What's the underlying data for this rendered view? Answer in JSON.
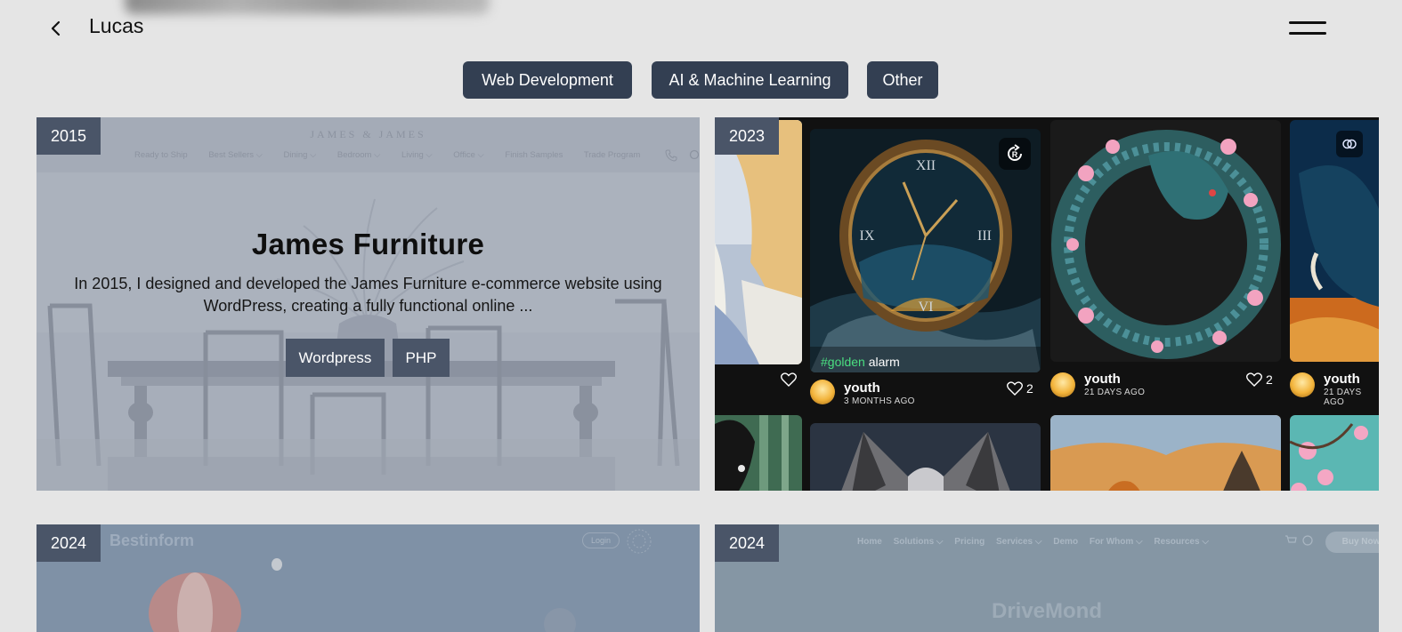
{
  "header": {
    "title": "Lucas"
  },
  "filters": [
    "Web Development",
    "AI & Machine Learning",
    "Other"
  ],
  "projects": [
    {
      "year": "2015",
      "title": "James Furniture",
      "description": "In 2015, I designed and developed the James Furniture e-commerce website using WordPress, creating a fully functional online ...",
      "tags": [
        "Wordpress",
        "PHP"
      ],
      "screenshot": {
        "brand": "JAMES & JAMES",
        "nav": [
          "Ready to Ship",
          "Best Sellers ⌵",
          "Dining ⌵",
          "Bedroom ⌵",
          "Living ⌵",
          "Office ⌵",
          "Finish Samples",
          "Trade Program"
        ]
      }
    },
    {
      "year": "2023",
      "screenshot": {
        "caption_tag": "#golden",
        "caption_word": "alarm",
        "posts": [
          {
            "user": "youth",
            "ago": "3 MONTHS AGO",
            "likes": "2"
          },
          {
            "user": "youth",
            "ago": "21 DAYS AGO",
            "likes": "2"
          },
          {
            "user": "youth",
            "ago": "21 DAYS AGO"
          }
        ]
      }
    },
    {
      "year": "2024",
      "screenshot": {
        "brand": "Bestinform",
        "login": "Login"
      }
    },
    {
      "year": "2024",
      "screenshot": {
        "nav": [
          "Home",
          "Solutions ⌵",
          "Pricing",
          "Services ⌵",
          "Demo",
          "For Whom ⌵",
          "Resources ⌵"
        ],
        "cta": "Buy Now",
        "brand": "DriveMond"
      }
    }
  ],
  "colors": {
    "background": "#e5e5e5",
    "button": "#333f52",
    "tag": "#4a5568",
    "hashtag": "#4ade80"
  }
}
